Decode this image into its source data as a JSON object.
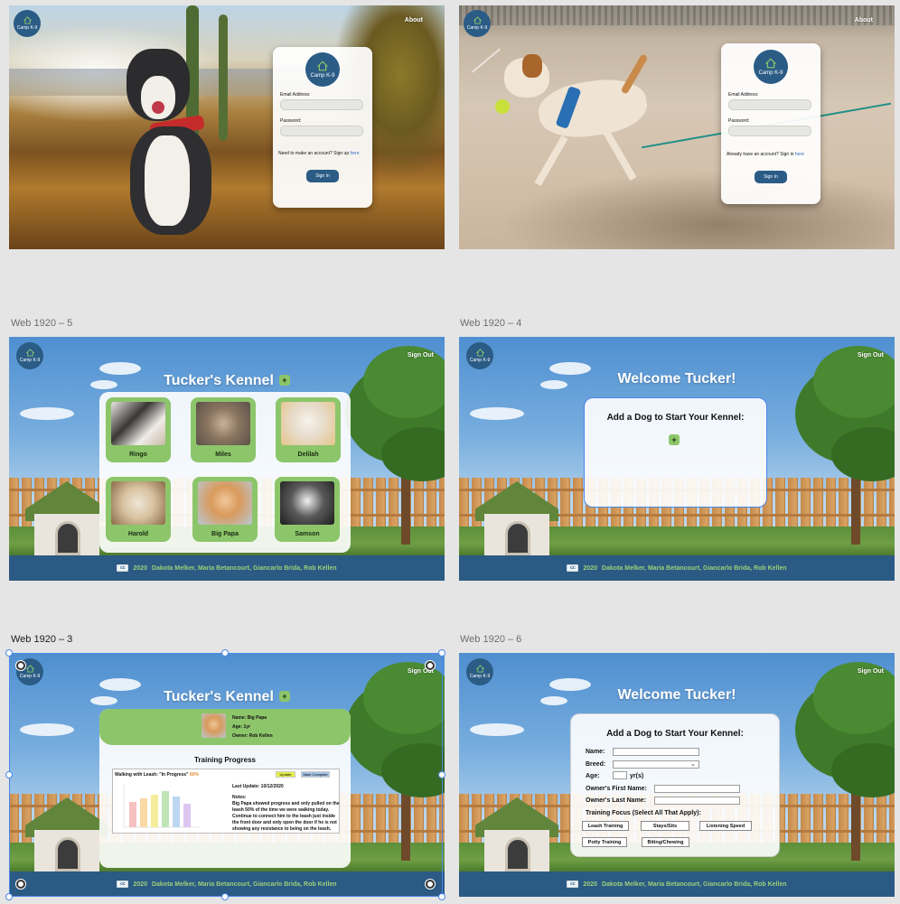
{
  "frames": {
    "web5_label": "Web 1920 – 5",
    "web4_label": "Web 1920 – 4",
    "web3_label": "Web 1920 – 3",
    "web6_label": "Web 1920 – 6"
  },
  "brand": {
    "logo_text": "Camp K-9",
    "accent": "#2b5c86",
    "green": "#8cc56a"
  },
  "login1": {
    "nav": "About",
    "email_label": "Email Address:",
    "password_label": "Password:",
    "signup_text": "Need to make an account?  Sign up ",
    "signup_link": "here",
    "button": "Sign In"
  },
  "login2": {
    "nav": "About",
    "email_label": "Email Address:",
    "password_label": "Password:",
    "signin_text": "Already have an account?  Sign in ",
    "signin_link": "here",
    "button": "Sign In"
  },
  "kennel": {
    "nav": "Sign Out",
    "title": "Tucker's Kennel",
    "add": "+",
    "dogs": [
      "Ringo",
      "Miles",
      "Delilah",
      "Harold",
      "Big Papa",
      "Samson"
    ]
  },
  "welcome": {
    "nav": "Sign Out",
    "title": "Welcome Tucker!",
    "prompt": "Add a Dog to Start Your Kennel:",
    "add": "+"
  },
  "detail": {
    "nav": "Sign Out",
    "title": "Tucker's Kennel",
    "add": "+",
    "name_line": "Name: Big Papa",
    "age_line": "Age: 1yr",
    "owner_line": "Owner: Rob Kellen",
    "section_title": "Training Progress",
    "goal_label": "Walking with Leash: \"In Progress\"",
    "goal_percent": "60%",
    "update_btn": "Update",
    "complete_btn": "Mark Complete",
    "last_update": "Last Update: 10/12/2020",
    "notes_label": "Notes:",
    "notes": "Big Papa showed progress and only pulled on the leash 50% of the time we were walking today. Continue to connect him to the leash just inside the front door and only open the door if he is not showing any resistance to being on the leash."
  },
  "form": {
    "nav": "Sign Out",
    "title": "Welcome Tucker!",
    "heading": "Add a Dog to Start Your Kennel:",
    "name": "Name:",
    "breed": "Breed:",
    "age": "Age:",
    "age_unit": "yr(s)",
    "owner_first": "Owner's First Name:",
    "owner_last": "Owner's Last Name:",
    "focus": "Training Focus (Select All That Apply):",
    "options": [
      "Leash Training",
      "Stays/Sits",
      "Listening Speed",
      "Potty Training",
      "Biting/Chewing"
    ]
  },
  "footer": {
    "cc": "cc",
    "year": "2020",
    "authors": "Dakota Melker, Maria Betancourt, Giancarlo Brida, Rob Kellen"
  }
}
